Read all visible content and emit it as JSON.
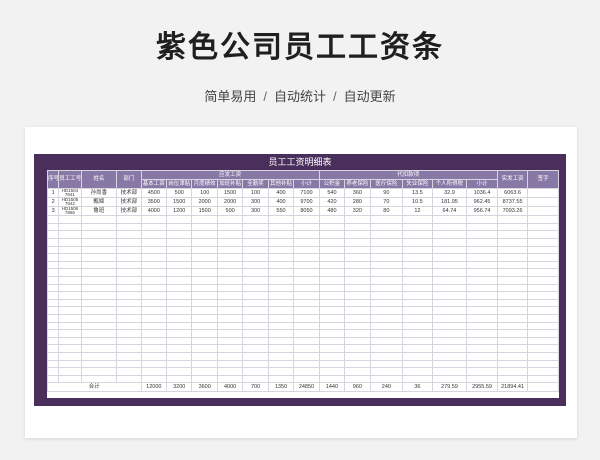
{
  "hero": {
    "title": "紫色公司员工工资条",
    "tags": [
      "简单易用",
      "自动统计",
      "自动更新"
    ],
    "separator": "/"
  },
  "sheet": {
    "title": "员工工资明细表",
    "group_headers": {
      "payable": "应发工资",
      "withhold": "代扣款项"
    },
    "columns": {
      "seq": "序号",
      "emp_id": "员工工号",
      "name": "姓名",
      "dept": "部门",
      "basic": "基本工资",
      "post": "岗位津贴",
      "perf": "月度绩效",
      "allowance": "加班补贴",
      "attend": "全勤奖",
      "other": "其他补贴",
      "subtotal1": "小计",
      "fund": "公积金",
      "pension": "养老保险",
      "medical": "医疗保险",
      "unemp": "失业保险",
      "tax": "个人所得税",
      "subtotal2": "小计",
      "net": "实发工资",
      "sign": "签字"
    },
    "rows": [
      [
        "1",
        "HD1504 7841",
        "孙尚香",
        "技术部",
        "4500",
        "500",
        "100",
        "1500",
        "100",
        "400",
        "7100",
        "540",
        "360",
        "90",
        "13.5",
        "32.9",
        "1036.4",
        "6063.6",
        ""
      ],
      [
        "2",
        "HD1505 7842",
        "甄姬",
        "技术部",
        "3500",
        "1500",
        "2000",
        "2000",
        "300",
        "400",
        "9700",
        "420",
        "280",
        "70",
        "10.5",
        "181.95",
        "962.45",
        "8737.55",
        ""
      ],
      [
        "3",
        "HD1506 7866",
        "鲁班",
        "技术部",
        "4000",
        "1200",
        "1500",
        "500",
        "300",
        "550",
        "8050",
        "480",
        "320",
        "80",
        "12",
        "64.74",
        "956.74",
        "7093.26",
        ""
      ]
    ],
    "total": {
      "label": "合计",
      "values": [
        "12000",
        "3200",
        "3600",
        "4000",
        "700",
        "1350",
        "24850",
        "1440",
        "960",
        "240",
        "36",
        "279.59",
        "2955.59",
        "21894.41"
      ]
    }
  }
}
